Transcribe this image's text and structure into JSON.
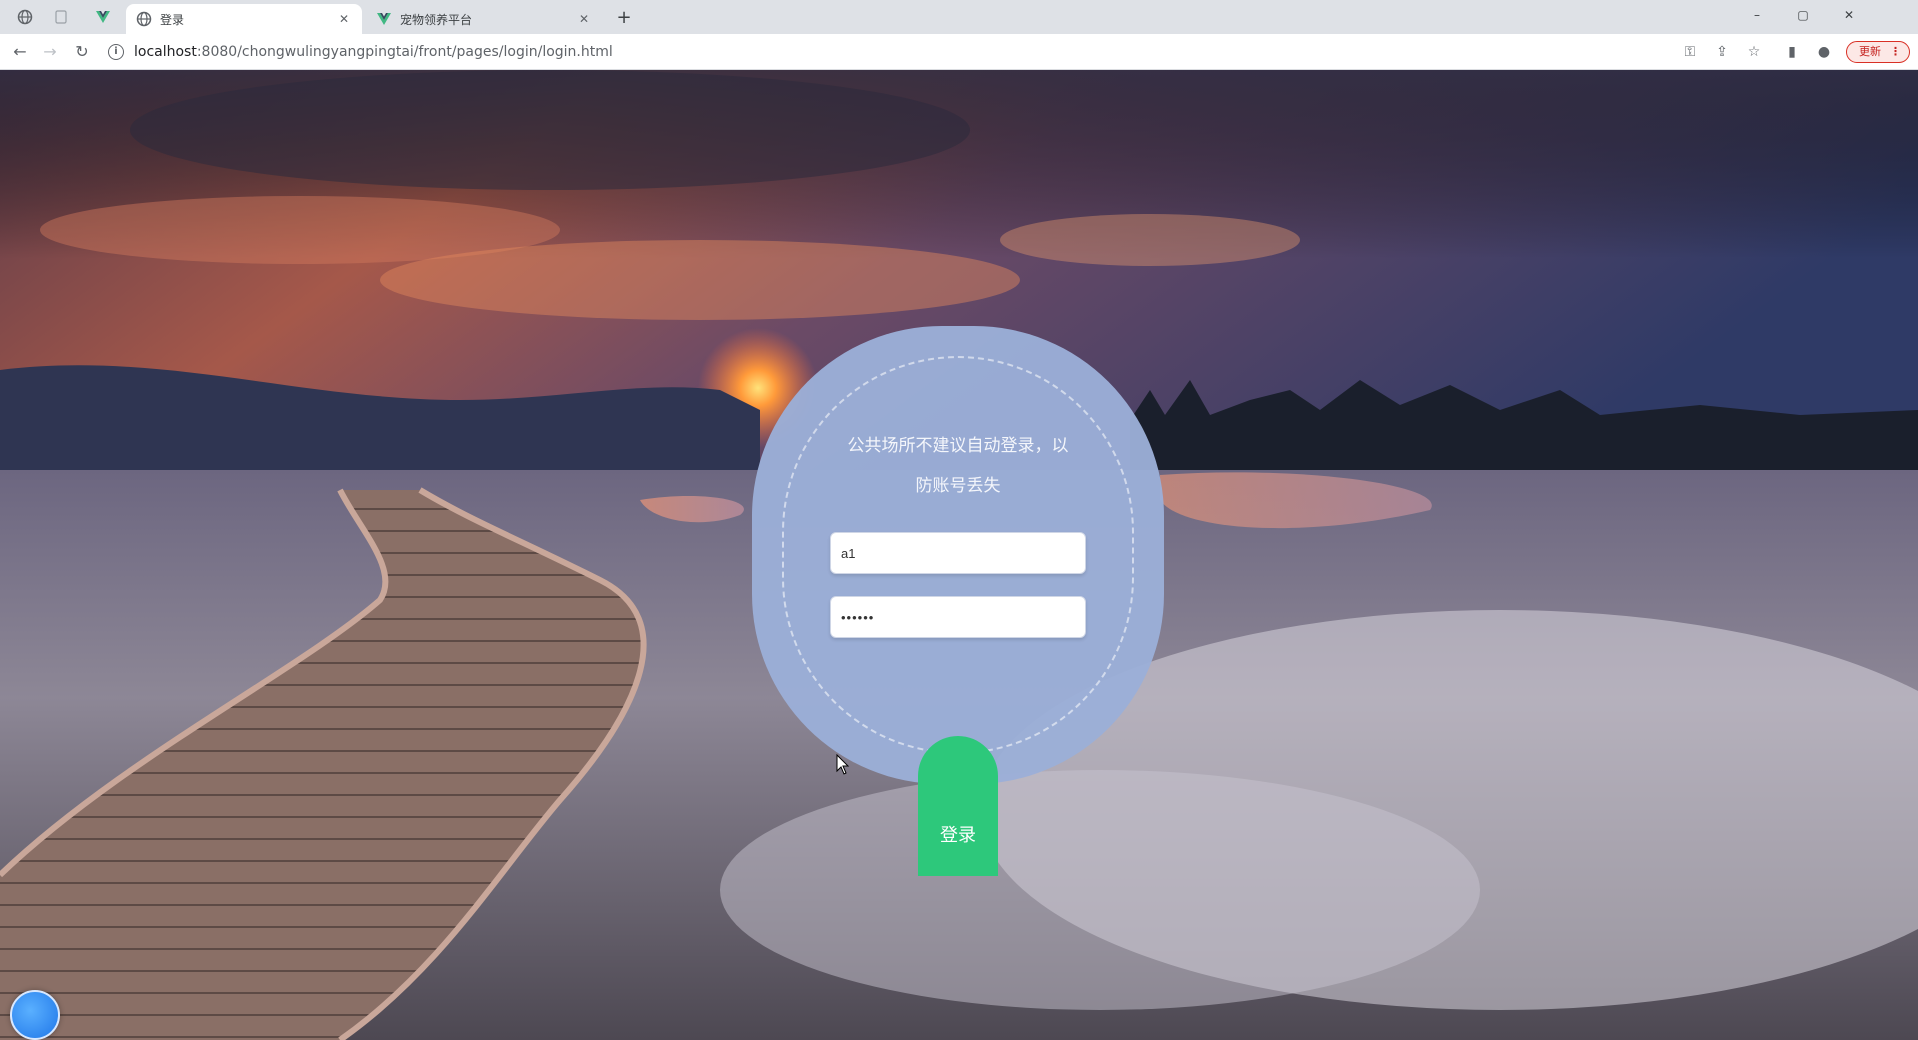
{
  "browser": {
    "tabs": [
      {
        "title": "登录",
        "active": true,
        "icon": "globe-icon"
      },
      {
        "title": "宠物领养平台",
        "active": false,
        "icon": "vue-icon"
      }
    ],
    "new_tab_label": "+",
    "address": {
      "host": "localhost",
      "path": ":8080/chongwulingyangpingtai/front/pages/login/login.html"
    },
    "update_label": "更新",
    "window_controls": [
      "–",
      "▢",
      "✕"
    ]
  },
  "login": {
    "notice": "公共场所不建议自动登录，以防账号丢失",
    "username_value": "a1",
    "password_value": "••••••",
    "submit_label": "登录"
  },
  "colors": {
    "card": "#9bafd7",
    "button": "#2dc87b",
    "accent_blue": "#1f76e8"
  }
}
